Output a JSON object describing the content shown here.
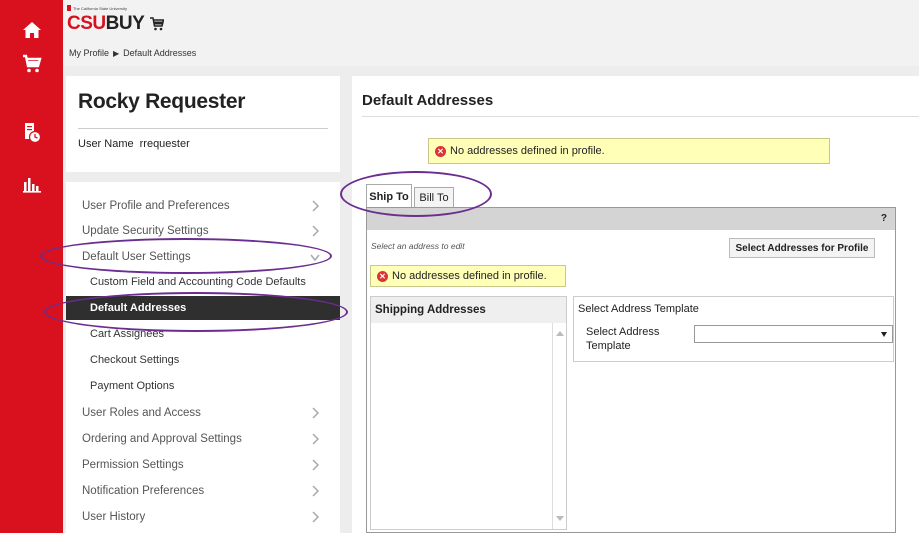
{
  "rail": {
    "icons": [
      "home-icon",
      "cart-icon",
      "orders-clock-icon",
      "reports-bar-chart-icon"
    ]
  },
  "header": {
    "logo_tagline": "The California State University",
    "logo_csu": "CSU",
    "logo_buy": "BUY",
    "breadcrumb": {
      "parent": "My Profile",
      "separator": "▶",
      "current": "Default Addresses"
    }
  },
  "profile": {
    "name": "Rocky Requester",
    "username_label": "User Name",
    "username_value": "rrequester"
  },
  "menu": {
    "items": [
      {
        "label": "User Profile and Preferences"
      },
      {
        "label": "Update Security Settings"
      },
      {
        "label": "Default User Settings"
      }
    ],
    "subitems": [
      {
        "label": "Custom Field and Accounting Code Defaults"
      },
      {
        "label": "Default Addresses"
      },
      {
        "label": "Cart Assignees"
      },
      {
        "label": "Checkout Settings"
      },
      {
        "label": "Payment Options"
      }
    ],
    "items_after": [
      {
        "label": "User Roles and Access"
      },
      {
        "label": "Ordering and Approval Settings"
      },
      {
        "label": "Permission Settings"
      },
      {
        "label": "Notification Preferences"
      },
      {
        "label": "User History"
      }
    ]
  },
  "content": {
    "title": "Default Addresses",
    "top_alert": "No addresses defined in profile.",
    "tabs": [
      {
        "label": "Ship To",
        "active": true
      },
      {
        "label": "Bill To",
        "active": false
      }
    ],
    "help": "?",
    "select_hint": "Select an address to edit",
    "select_button": "Select Addresses for Profile",
    "inner_alert": "No addresses defined in profile.",
    "shipping_header": "Shipping Addresses",
    "template": {
      "title": "Select Address Template",
      "label": "Select Address Template",
      "value": ""
    }
  },
  "colors": {
    "rail": "#d9111e",
    "alert_bg": "#ffffb8",
    "active_menu": "#2f2f2f",
    "annotation": "#6b2d8f"
  }
}
